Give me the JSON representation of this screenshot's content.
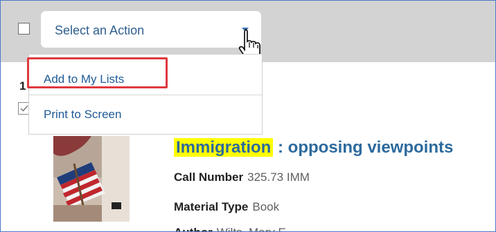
{
  "toolbar": {
    "select": {
      "label": "Select an Action"
    }
  },
  "menu": {
    "items": [
      {
        "label": "Add to My Lists"
      },
      {
        "label": "Print to Screen"
      }
    ]
  },
  "result": {
    "number": "1",
    "title_highlight": "Immigration",
    "title_rest": " : opposing viewpoints",
    "fields": [
      {
        "label": "Call Number",
        "value": "325.73 IMM"
      },
      {
        "label": "Material Type",
        "value": "Book"
      },
      {
        "label": "Author",
        "value": "Wilts, Mary E."
      }
    ]
  },
  "colors": {
    "accent": "#2d6a9d",
    "highlight": "#ffff00",
    "annotation": "#e0393e",
    "toolbar_bg": "#d3d3d3"
  }
}
